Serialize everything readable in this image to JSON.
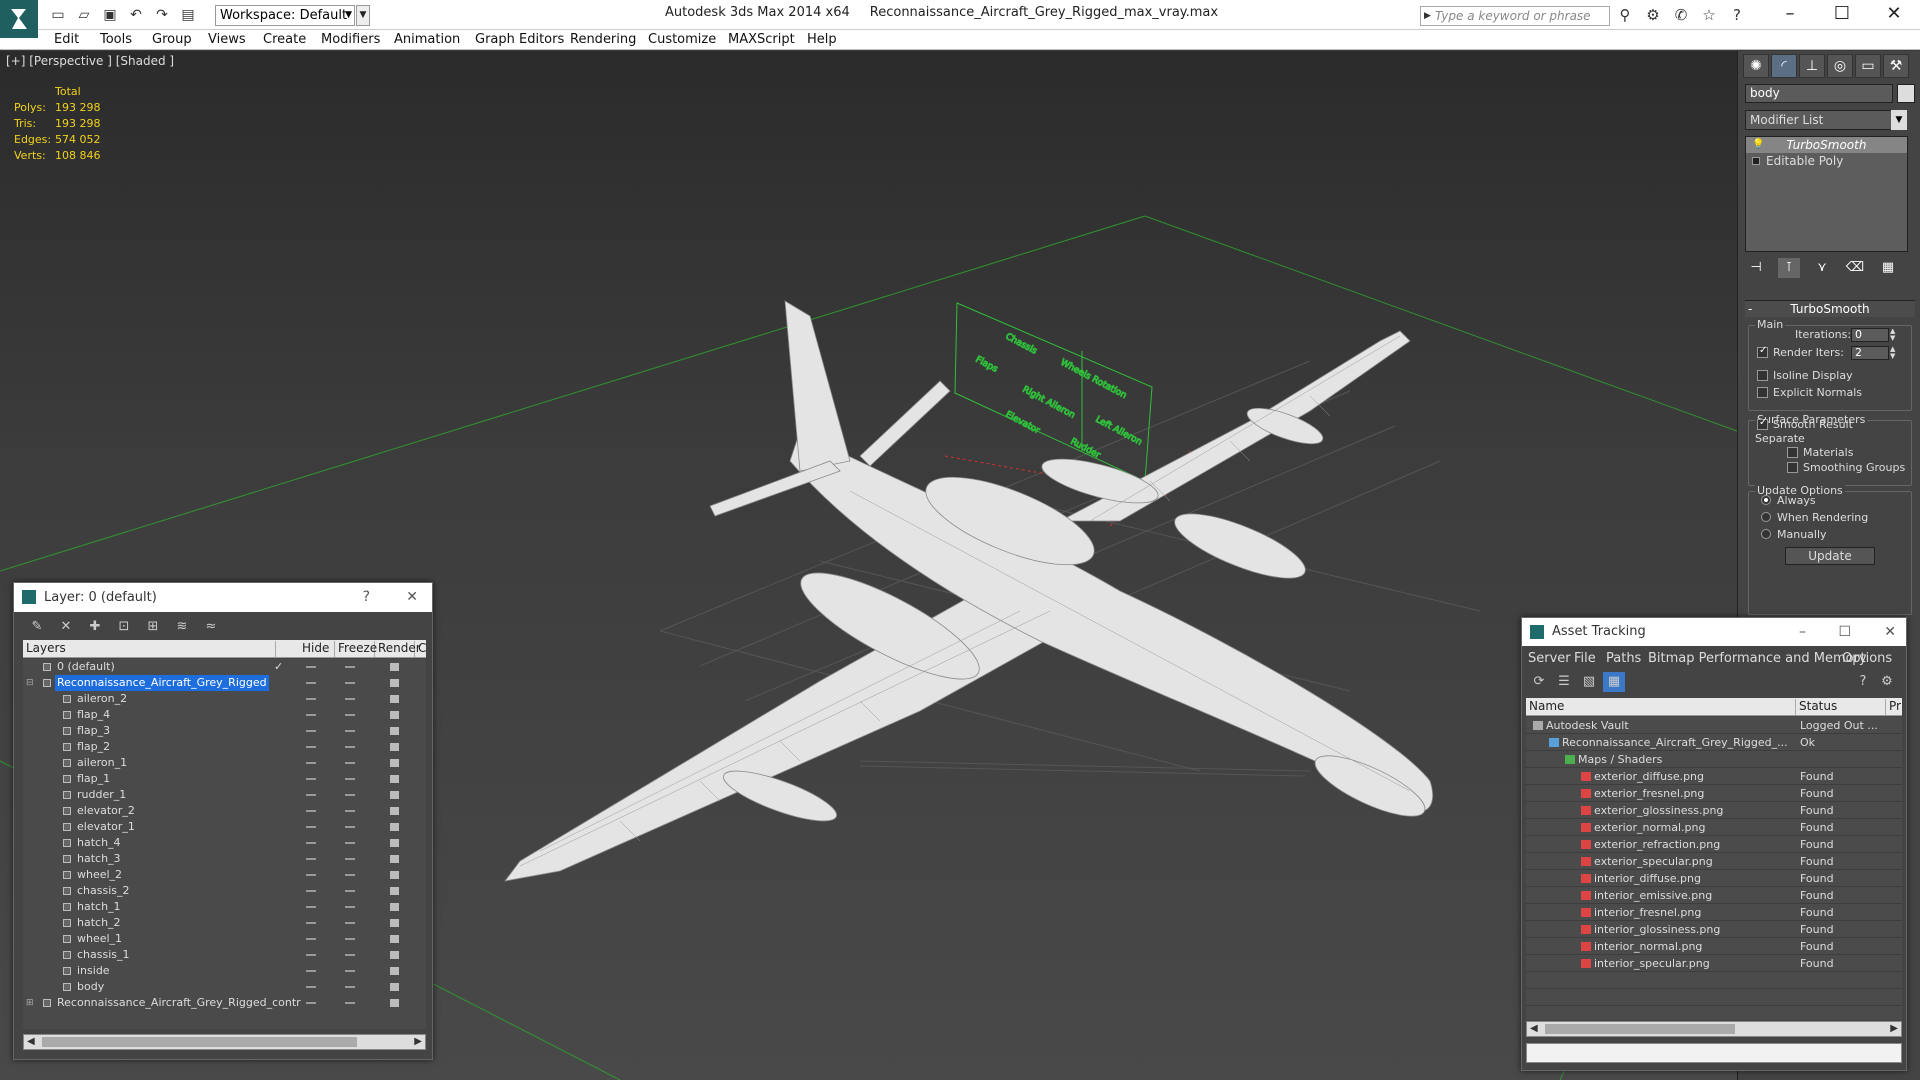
{
  "title": {
    "app": "Autodesk 3ds Max  2014 x64",
    "file": "Reconnaissance_Aircraft_Grey_Rigged_max_vray.max",
    "workspace": "Workspace: Default",
    "search_placeholder": "Type a keyword or phrase"
  },
  "menu": [
    "Edit",
    "Tools",
    "Group",
    "Views",
    "Create",
    "Modifiers",
    "Animation",
    "Graph Editors",
    "Rendering",
    "Customize",
    "MAXScript",
    "Help"
  ],
  "viewport": {
    "label": "[+] [Perspective ] [Shaded ]",
    "stats": {
      "header": "Total",
      "rows": [
        {
          "k": "Polys:",
          "v": "193 298"
        },
        {
          "k": "Tris:",
          "v": "193 298"
        },
        {
          "k": "Edges:",
          "v": "574 052"
        },
        {
          "k": "Verts:",
          "v": "108 846"
        }
      ]
    },
    "rig_labels": [
      "Chassis",
      "Wheels Rotation",
      "Flaps",
      "Right Aileron",
      "Elevator",
      "Left Aileron",
      "Rudder"
    ]
  },
  "command_panel": {
    "object_name": "body",
    "modifier_list": "Modifier List",
    "stack": [
      "TurboSmooth",
      "Editable Poly"
    ],
    "rollout_title": "TurboSmooth",
    "main_group": "Main",
    "iterations_label": "Iterations:",
    "iterations_value": "0",
    "render_iters_label": "Render Iters:",
    "render_iters_value": "2",
    "isoline_display": "Isoline Display",
    "explicit_normals": "Explicit Normals",
    "surface_group": "Surface Parameters",
    "smooth_result": "Smooth Result",
    "separate": "Separate",
    "materials": "Materials",
    "smoothing_groups": "Smoothing Groups",
    "update_group": "Update Options",
    "always": "Always",
    "when_rendering": "When Rendering",
    "manually": "Manually",
    "update_button": "Update"
  },
  "layer_window": {
    "title": "Layer: 0 (default)",
    "help": "?",
    "close": "✕",
    "columns": [
      "Layers",
      "Hide",
      "Freeze",
      "Render",
      "C"
    ],
    "rows": [
      {
        "name": "0 (default)",
        "level": 1,
        "type": "layer",
        "check": "✓"
      },
      {
        "name": "Reconnaissance_Aircraft_Grey_Rigged",
        "level": 1,
        "type": "layer",
        "selected": true
      },
      {
        "name": "aileron_2",
        "level": 2,
        "type": "obj"
      },
      {
        "name": "flap_4",
        "level": 2,
        "type": "obj"
      },
      {
        "name": "flap_3",
        "level": 2,
        "type": "obj"
      },
      {
        "name": "flap_2",
        "level": 2,
        "type": "obj"
      },
      {
        "name": "aileron_1",
        "level": 2,
        "type": "obj"
      },
      {
        "name": "flap_1",
        "level": 2,
        "type": "obj"
      },
      {
        "name": "rudder_1",
        "level": 2,
        "type": "obj"
      },
      {
        "name": "elevator_2",
        "level": 2,
        "type": "obj"
      },
      {
        "name": "elevator_1",
        "level": 2,
        "type": "obj"
      },
      {
        "name": "hatch_4",
        "level": 2,
        "type": "obj"
      },
      {
        "name": "hatch_3",
        "level": 2,
        "type": "obj"
      },
      {
        "name": "wheel_2",
        "level": 2,
        "type": "obj"
      },
      {
        "name": "chassis_2",
        "level": 2,
        "type": "obj"
      },
      {
        "name": "hatch_1",
        "level": 2,
        "type": "obj"
      },
      {
        "name": "hatch_2",
        "level": 2,
        "type": "obj"
      },
      {
        "name": "wheel_1",
        "level": 2,
        "type": "obj"
      },
      {
        "name": "chassis_1",
        "level": 2,
        "type": "obj"
      },
      {
        "name": "inside",
        "level": 2,
        "type": "obj"
      },
      {
        "name": "body",
        "level": 2,
        "type": "obj"
      },
      {
        "name": "Reconnaissance_Aircraft_Grey_Rigged_contr",
        "level": 1,
        "type": "layer"
      }
    ]
  },
  "asset_window": {
    "title": "Asset Tracking",
    "menu": [
      "Server",
      "File",
      "Paths",
      "Bitmap Performance and Memory",
      "Options"
    ],
    "columns": [
      "Name",
      "Status",
      "Pr"
    ],
    "rows": [
      {
        "name": "Autodesk Vault",
        "status": "Logged Out ...",
        "level": 0,
        "icon": "vault"
      },
      {
        "name": "Reconnaissance_Aircraft_Grey_Rigged_...",
        "status": "Ok",
        "level": 1,
        "icon": "max"
      },
      {
        "name": "Maps / Shaders",
        "status": "",
        "level": 2,
        "icon": "maps"
      },
      {
        "name": "exterior_diffuse.png",
        "status": "Found",
        "level": 3,
        "icon": "png"
      },
      {
        "name": "exterior_fresnel.png",
        "status": "Found",
        "level": 3,
        "icon": "png"
      },
      {
        "name": "exterior_glossiness.png",
        "status": "Found",
        "level": 3,
        "icon": "png"
      },
      {
        "name": "exterior_normal.png",
        "status": "Found",
        "level": 3,
        "icon": "png"
      },
      {
        "name": "exterior_refraction.png",
        "status": "Found",
        "level": 3,
        "icon": "png"
      },
      {
        "name": "exterior_specular.png",
        "status": "Found",
        "level": 3,
        "icon": "png"
      },
      {
        "name": "interior_diffuse.png",
        "status": "Found",
        "level": 3,
        "icon": "png"
      },
      {
        "name": "interior_emissive.png",
        "status": "Found",
        "level": 3,
        "icon": "png"
      },
      {
        "name": "interior_fresnel.png",
        "status": "Found",
        "level": 3,
        "icon": "png"
      },
      {
        "name": "interior_glossiness.png",
        "status": "Found",
        "level": 3,
        "icon": "png"
      },
      {
        "name": "interior_normal.png",
        "status": "Found",
        "level": 3,
        "icon": "png"
      },
      {
        "name": "interior_specular.png",
        "status": "Found",
        "level": 3,
        "icon": "png"
      }
    ]
  },
  "colors": {
    "accent": "#1e6ddc",
    "stats": "#f2d21a",
    "rig": "#2fbf3a",
    "wire": "#e6e6e6"
  }
}
